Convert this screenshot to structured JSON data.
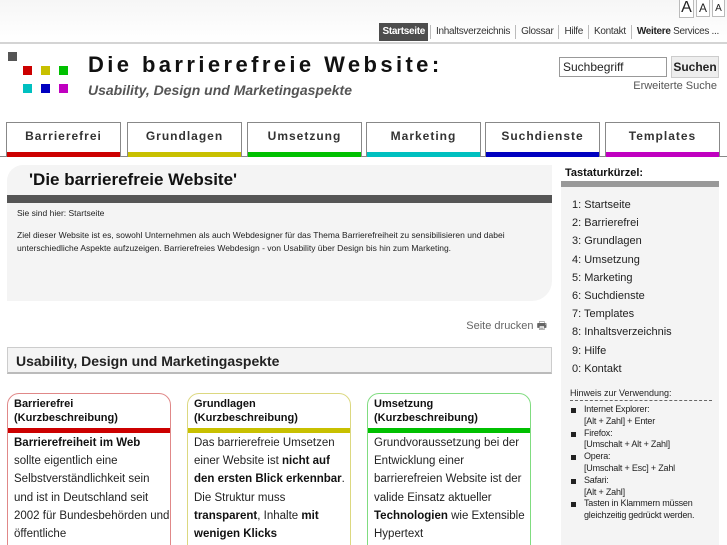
{
  "font_sizes": [
    "A",
    "A",
    "A"
  ],
  "service_nav": {
    "items": [
      "Startseite",
      "Inhaltsverzeichnis",
      "Glossar",
      "Hilfe",
      "Kontakt"
    ],
    "more_bold": "Weitere",
    "more_rest": " Services ..."
  },
  "header": {
    "title": "Die barrierefreie Website:",
    "subtitle": "Usability, Design und Marketingaspekte",
    "logo_colors": [
      "#555555",
      "#cc0000",
      "#c8c000",
      "#00c000",
      "#00c0c0",
      "#0000c0",
      "#c000c0"
    ]
  },
  "search": {
    "value": "Suchbegriff",
    "button": "Suchen",
    "advanced": "Erweiterte Suche"
  },
  "tabs": [
    {
      "label": "Barrierefrei",
      "color": "#cc0000"
    },
    {
      "label": "Grundlagen",
      "color": "#c8c000"
    },
    {
      "label": "Umsetzung",
      "color": "#00c000"
    },
    {
      "label": "Marketing",
      "color": "#00c0c0"
    },
    {
      "label": "Suchdienste",
      "color": "#0000c0"
    },
    {
      "label": "Templates",
      "color": "#c000c0"
    }
  ],
  "intro": {
    "heading": "'Die barrierefreie Website'",
    "breadcrumb": "Sie sind hier: Startseite",
    "text": "Ziel dieser Website ist es, sowohl Unternehmen als auch Webdesigner für das Thema Barrierefreiheit zu sensibilisieren und dabei unterschiedliche Aspekte aufzuzeigen. Barrierefreies Webdesign - von Usability über Design bis hin zum Marketing."
  },
  "print": {
    "label": "Seite drucken",
    "icon": "🖶"
  },
  "section_heading": "Usability, Design und Marketingaspekte",
  "cards": [
    {
      "title": "Barrierefrei",
      "subtitle": "(Kurzbeschreibung)",
      "color": "#cc0000",
      "border": "#e08888",
      "parts": [
        {
          "b": "Barrierefreiheit im Web"
        },
        {
          "t": " sollte eigentlich eine Selbstverständlichkeit sein und ist in Deutschland seit 2002 für Bundesbehörden und öffentliche"
        }
      ]
    },
    {
      "title": "Grundlagen",
      "subtitle": "(Kurzbeschreibung)",
      "color": "#c8c000",
      "border": "#dcd880",
      "parts": [
        {
          "t": "Das barrierefreie Umsetzen einer Website ist "
        },
        {
          "b": "nicht auf den ersten Blick erkennbar"
        },
        {
          "t": ". Die Struktur muss "
        },
        {
          "b": "transparent"
        },
        {
          "t": ", Inhalte "
        },
        {
          "b": "mit wenigen Klicks"
        }
      ]
    },
    {
      "title": "Umsetzung",
      "subtitle": "(Kurzbeschreibung)",
      "color": "#00c000",
      "border": "#80dc80",
      "parts": [
        {
          "t": "Grundvoraussetzung bei der Entwicklung einer barrierefreien Website ist der valide Einsatz aktueller "
        },
        {
          "b": "Technologien"
        },
        {
          "t": " wie Extensible Hypertext"
        }
      ]
    }
  ],
  "sidebar": {
    "heading": "Tastaturkürzel:",
    "shortcuts": [
      "1: Startseite",
      "2: Barrierefrei",
      "3: Grundlagen",
      "4: Umsetzung",
      "5: Marketing",
      "6: Suchdienste",
      "7: Templates",
      "8: Inhaltsverzeichnis",
      "9: Hilfe",
      "0: Kontakt"
    ],
    "hint_title": "Hinweis zur Verwendung:",
    "hints": [
      [
        "Internet Explorer:",
        "[Alt + Zahl] + Enter"
      ],
      [
        "Firefox:",
        "[Umschalt + Alt + Zahl]"
      ],
      [
        "Opera:",
        "[Umschalt + Esc] + Zahl"
      ],
      [
        "Safari:",
        "[Alt + Zahl]"
      ],
      [
        "Tasten in Klammern müssen gleichzeitig gedrückt werden."
      ]
    ]
  }
}
